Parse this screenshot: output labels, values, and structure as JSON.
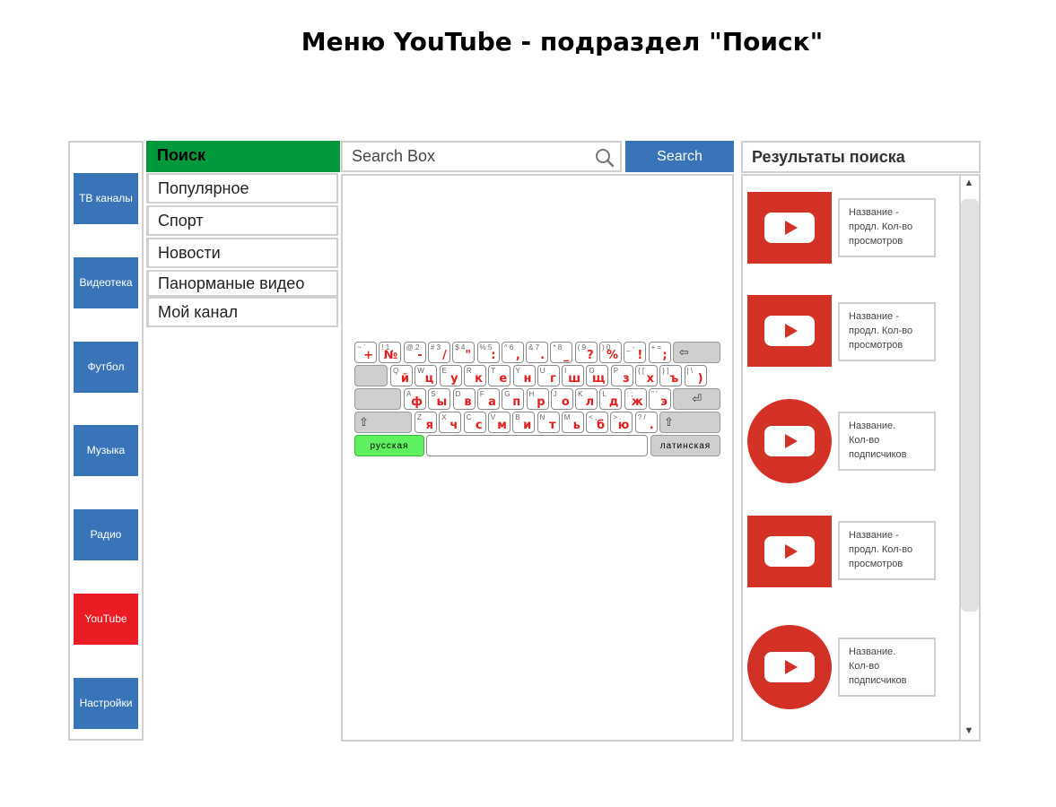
{
  "page_title": "Меню YouTube - подраздел \"Поиск\"",
  "sidebar": {
    "items": [
      {
        "label": "ТВ каналы",
        "active": false
      },
      {
        "label": "Видеотека",
        "active": false
      },
      {
        "label": "Футбол",
        "active": false
      },
      {
        "label": "Музыка",
        "active": false
      },
      {
        "label": "Радио",
        "active": false
      },
      {
        "label": "YouTube",
        "active": true
      },
      {
        "label": "Настройки",
        "active": false
      }
    ],
    "button_color": "#3a74b8",
    "active_color": "#ec1c24"
  },
  "menu": {
    "header": "Поиск",
    "header_color": "#009a3d",
    "items": [
      "Популярное",
      "Спорт",
      "Новости",
      "Панорманые видео",
      "Мой канал"
    ]
  },
  "search": {
    "placeholder": "Search Box",
    "button_label": "Search",
    "icon": "search-icon"
  },
  "keyboard": {
    "rows": [
      [
        {
          "l": "~ `",
          "r": "+"
        },
        {
          "l": "! 1",
          "r": "№"
        },
        {
          "l": "@ 2",
          "r": "-"
        },
        {
          "l": "# 3",
          "r": "/"
        },
        {
          "l": "$ 4",
          "r": "\""
        },
        {
          "l": "% 5",
          "r": ":"
        },
        {
          "l": "^ 6",
          "r": ","
        },
        {
          "l": "& 7",
          "r": "."
        },
        {
          "l": "* 8",
          "r": "_"
        },
        {
          "l": "( 9",
          "r": "?"
        },
        {
          "l": ") 0",
          "r": "%"
        },
        {
          "l": "_ -",
          "r": "!"
        },
        {
          "l": "+ =",
          "r": ";"
        }
      ],
      [
        {
          "l": "Q",
          "r": "й"
        },
        {
          "l": "W",
          "r": "ц"
        },
        {
          "l": "E",
          "r": "у"
        },
        {
          "l": "R",
          "r": "к"
        },
        {
          "l": "T",
          "r": "е"
        },
        {
          "l": "Y",
          "r": "н"
        },
        {
          "l": "U",
          "r": "г"
        },
        {
          "l": "I",
          "r": "ш"
        },
        {
          "l": "O",
          "r": "щ"
        },
        {
          "l": "P",
          "r": "з"
        },
        {
          "l": "{ [",
          "r": "х"
        },
        {
          "l": "} ]",
          "r": "ъ"
        },
        {
          "l": "| \\",
          "r": ")"
        }
      ],
      [
        {
          "l": "A",
          "r": "ф"
        },
        {
          "l": "S",
          "r": "ы"
        },
        {
          "l": "D",
          "r": "в"
        },
        {
          "l": "F",
          "r": "а"
        },
        {
          "l": "G",
          "r": "п"
        },
        {
          "l": "H",
          "r": "р"
        },
        {
          "l": "J",
          "r": "о"
        },
        {
          "l": "K",
          "r": "л"
        },
        {
          "l": "L",
          "r": "д"
        },
        {
          "l": ": ;",
          "r": "ж"
        },
        {
          "l": "\" '",
          "r": "э"
        }
      ],
      [
        {
          "l": "Z",
          "r": "я"
        },
        {
          "l": "X",
          "r": "ч"
        },
        {
          "l": "C",
          "r": "с"
        },
        {
          "l": "V",
          "r": "м"
        },
        {
          "l": "B",
          "r": "и"
        },
        {
          "l": "N",
          "r": "т"
        },
        {
          "l": "M",
          "r": "ь"
        },
        {
          "l": "< ,",
          "r": "б"
        },
        {
          "l": "> .",
          "r": "ю"
        },
        {
          "l": "? /",
          "r": "."
        }
      ]
    ],
    "backspace_symbol": "⇦",
    "enter_symbol": "⏎",
    "shift_symbol": "⇧",
    "lang_ru": "русская",
    "lang_lat": "латинская"
  },
  "results": {
    "header": "Результаты поиска",
    "items": [
      {
        "type": "video",
        "lines": [
          "Название  -",
          "продл. Кол-во",
          "просмотров"
        ]
      },
      {
        "type": "video",
        "lines": [
          "Название  -",
          "продл. Кол-во",
          "просмотров"
        ]
      },
      {
        "type": "channel",
        "lines": [
          "Название.",
          "Кол-во",
          "подписчиков"
        ]
      },
      {
        "type": "video",
        "lines": [
          "Название  -",
          "продл. Кол-во",
          "просмотров"
        ]
      },
      {
        "type": "channel",
        "lines": [
          "Название.",
          "Кол-во",
          "подписчиков"
        ]
      }
    ],
    "thumb_color": "#d33125"
  }
}
